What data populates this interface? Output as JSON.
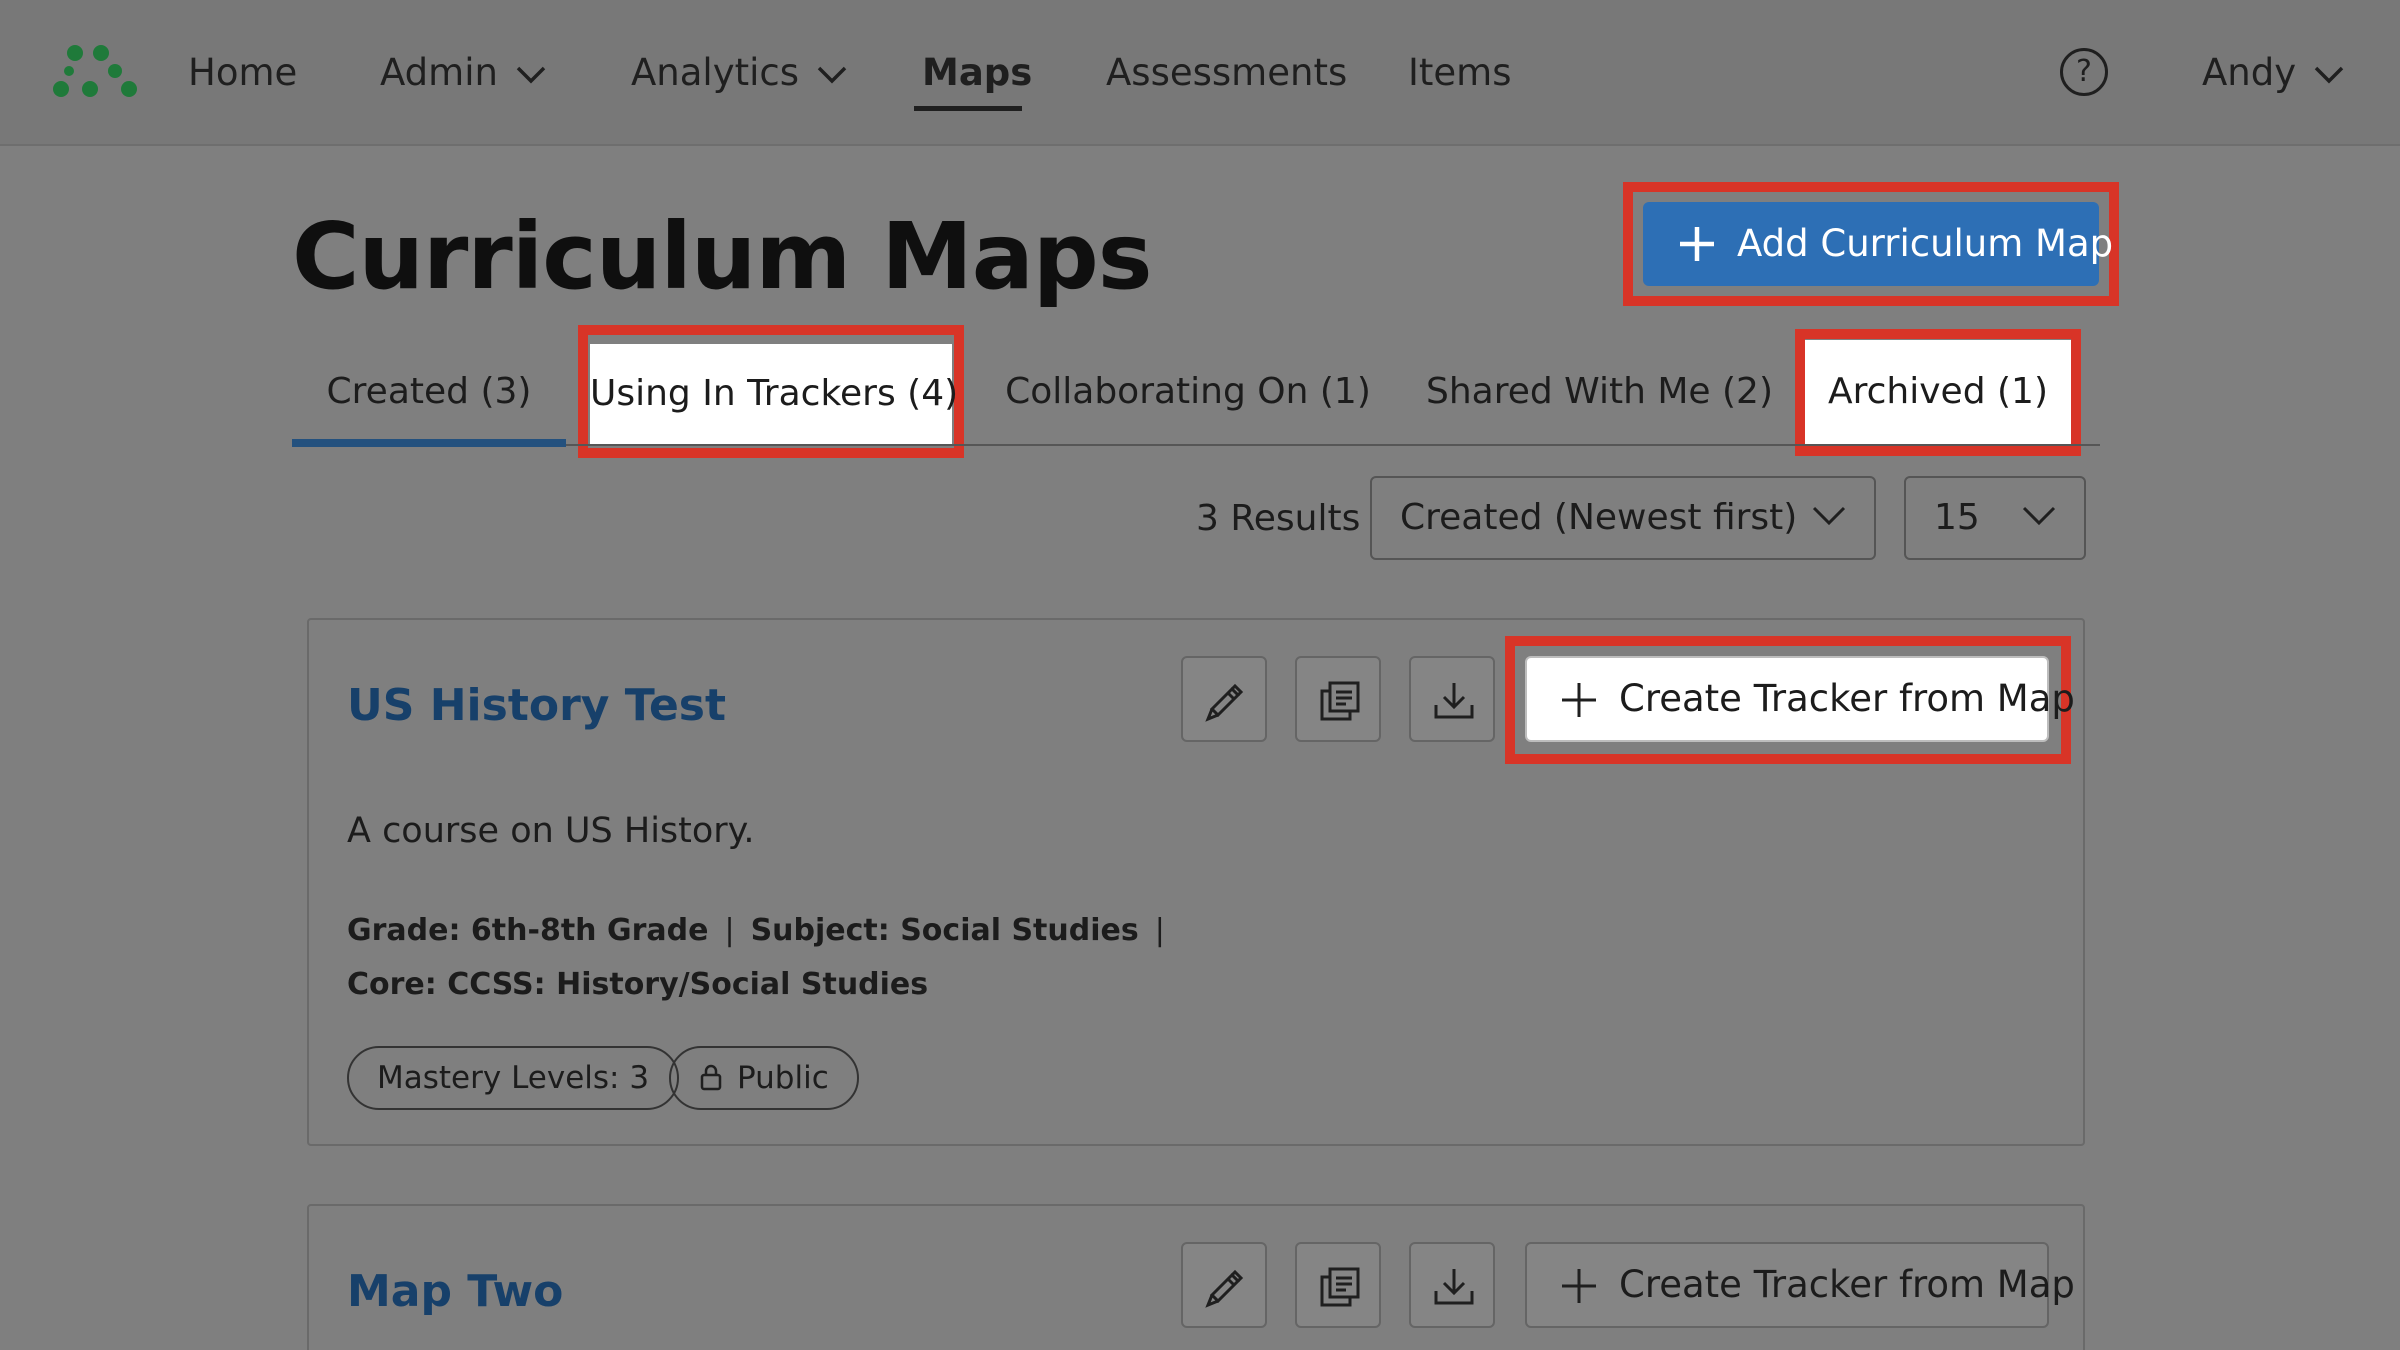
{
  "nav": {
    "items": [
      {
        "label": "Home"
      },
      {
        "label": "Admin"
      },
      {
        "label": "Analytics"
      },
      {
        "label": "Maps"
      },
      {
        "label": "Assessments"
      },
      {
        "label": "Items"
      }
    ],
    "help_label": "?",
    "user_name": "Andy",
    "active": "Maps"
  },
  "header": {
    "title": "Curriculum Maps",
    "add_button_label": "Add Curriculum Map"
  },
  "tabs": [
    {
      "label": "Created (3)",
      "active": true
    },
    {
      "label": "Using In Trackers (4)",
      "highlighted": true
    },
    {
      "label": "Collaborating On (1)"
    },
    {
      "label": "Shared With Me (2)"
    },
    {
      "label": "Archived (1)",
      "highlighted": true
    }
  ],
  "results": {
    "count_label": "3 Results",
    "sort_value": "Created (Newest first)",
    "per_page_value": "15"
  },
  "cards": [
    {
      "title": "US History Test",
      "description": "A course on US History.",
      "grade": "Grade: 6th-8th Grade",
      "subject": "Subject: Social Studies",
      "core": "Core: CCSS: History/Social Studies",
      "mastery_label": "Mastery Levels: 3",
      "visibility_label": "Public",
      "tracker_button_label": "Create Tracker from Map"
    },
    {
      "title": "Map Two",
      "tracker_button_label": "Create Tracker from Map"
    }
  ],
  "colors": {
    "accent": "#2d6fb5",
    "highlight": "#d83427",
    "card_title": "#17406a",
    "logo": "#1f7a3a"
  }
}
